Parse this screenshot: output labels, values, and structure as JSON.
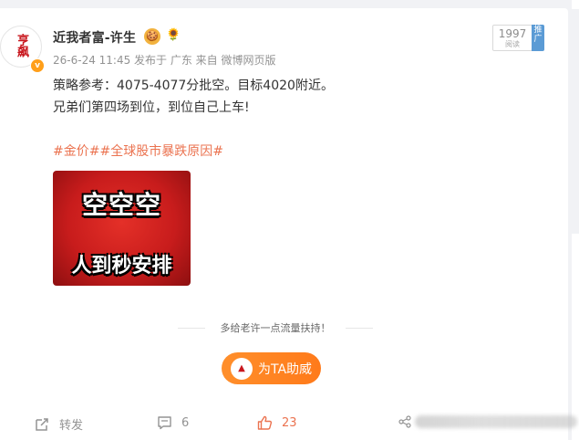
{
  "author": {
    "name": "近我者富-许生",
    "avatar_text": "亨飙",
    "verified_symbol": "v"
  },
  "post": {
    "meta": "26-6-24 11:45 发布于 广东 来自 微博网页版",
    "line1": "策略参考：4075-4077分批空。目标4020附近。",
    "line2": "兄弟们第四场到位，到位自己上车!",
    "tags": "#金价##全球股市暴跌原因#"
  },
  "stats": {
    "read_count": "1997",
    "read_label": "阅读",
    "promote_label": "推广"
  },
  "media": {
    "line1": "空空空",
    "line2": "人到秒安排"
  },
  "support": {
    "text": "多给老许一点流量扶持！",
    "button_label": "为TA助威"
  },
  "actions": {
    "forward_label": "转发",
    "comment_count": "6",
    "like_count": "23"
  },
  "icons": {
    "forward": "forward-icon",
    "comment": "comment-icon",
    "like": "thumbs-up-icon",
    "share": "share-icon"
  },
  "colors": {
    "accent": "#eb7350",
    "boost": "#ff8f2b",
    "promote": "#5b9bd5",
    "verified": "#ff9f1a"
  }
}
